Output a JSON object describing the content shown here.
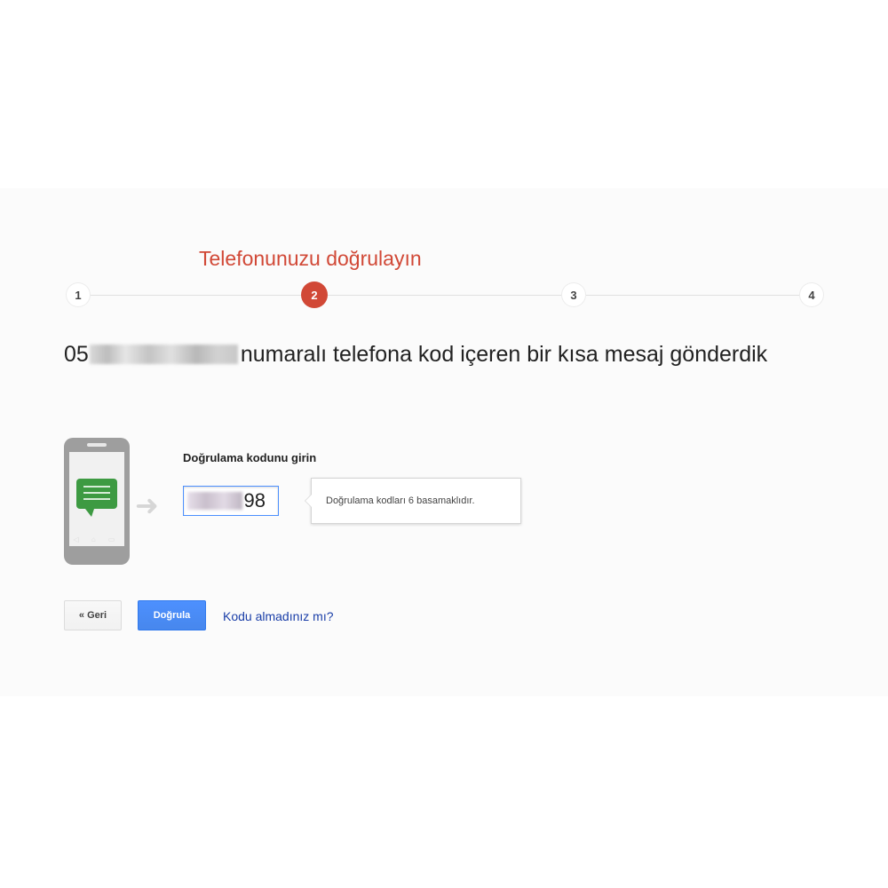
{
  "header": {
    "title": "Telefonunuzu doğrulayın"
  },
  "steps": [
    {
      "label": "1",
      "active": false
    },
    {
      "label": "2",
      "active": true
    },
    {
      "label": "3",
      "active": false
    },
    {
      "label": "4",
      "active": false
    }
  ],
  "message": {
    "prefix": "05",
    "suffix": "numaralı telefona kod içeren bir kısa mesaj gönderdik"
  },
  "form": {
    "label": "Doğrulama kodunu girin",
    "code_value": "98",
    "tooltip": "Doğrulama kodları 6 basamaklıdır."
  },
  "actions": {
    "back_label": "« Geri",
    "verify_label": "Doğrula",
    "resend_link": "Kodu almadınız mı?"
  },
  "colors": {
    "accent_red": "#d14836",
    "primary_blue": "#4d90fe",
    "link_blue": "#1a3ea8",
    "bubble_green": "#3d9a42"
  },
  "icons": [
    "phone-icon",
    "message-bubble-icon",
    "arrow-right-icon"
  ]
}
